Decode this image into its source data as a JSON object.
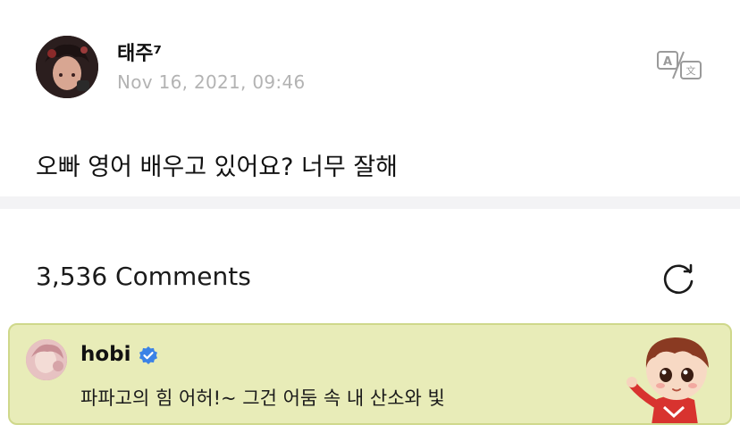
{
  "post": {
    "author": "태주⁷",
    "date": "Nov 16, 2021, 09:46",
    "body": "오빠 영어 배우고 있어요? 너무 잘해",
    "translate_icon": "translate-icon"
  },
  "comments": {
    "count_label": "3,536 Comments",
    "refresh_icon": "refresh-icon"
  },
  "pinned_comment": {
    "author": "hobi",
    "verified": true,
    "text": "파파고의 힘 어허!~ 그건 어둠 속 내 산소와 빛",
    "background_color": "#e8ecb8",
    "border_color": "#cfd88b",
    "verified_color": "#3b82e6"
  }
}
